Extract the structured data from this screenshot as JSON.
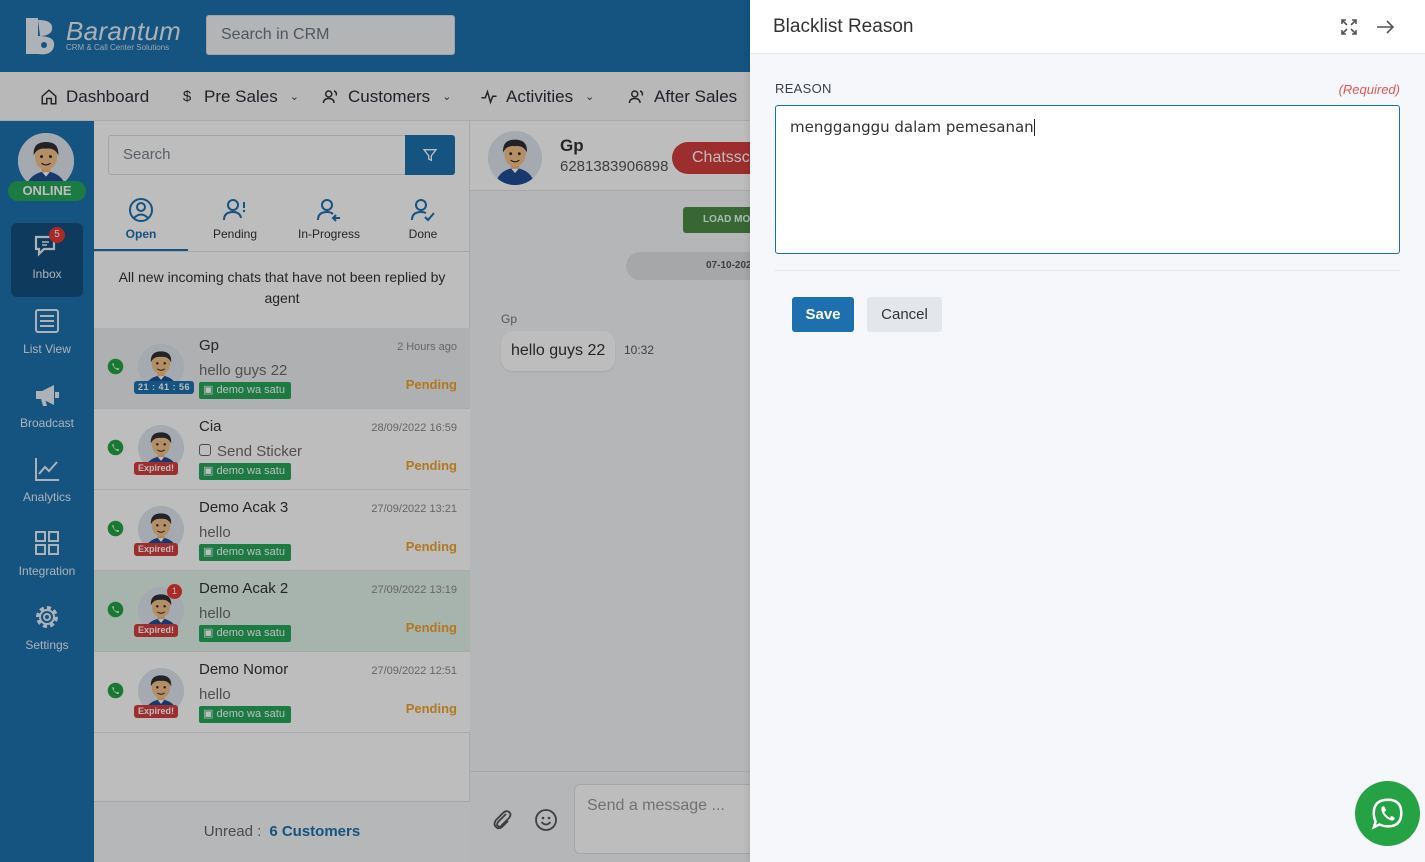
{
  "brand": {
    "name": "Barantum",
    "tagline": "CRM & Call Center Solutions",
    "accent": "#1d70ad"
  },
  "top_search": {
    "placeholder": "Search in CRM"
  },
  "nav": [
    {
      "label": "Dashboard",
      "icon": "home-icon"
    },
    {
      "label": "Pre Sales",
      "icon": "dollar-icon"
    },
    {
      "label": "Customers",
      "icon": "users-icon"
    },
    {
      "label": "Activities",
      "icon": "pulse-icon"
    },
    {
      "label": "After Sales",
      "icon": "users-icon"
    }
  ],
  "agent": {
    "status": "ONLINE"
  },
  "sidebar": [
    {
      "label": "Inbox",
      "icon": "chat-icon",
      "badge": "5"
    },
    {
      "label": "List View",
      "icon": "list-icon"
    },
    {
      "label": "Broadcast",
      "icon": "megaphone-icon"
    },
    {
      "label": "Analytics",
      "icon": "chart-icon"
    },
    {
      "label": "Integration",
      "icon": "grid-icon"
    },
    {
      "label": "Settings",
      "icon": "gear-icon"
    }
  ],
  "chatlist": {
    "search_placeholder": "Search",
    "tabs": [
      {
        "label": "Open",
        "icon": "user-circle-icon"
      },
      {
        "label": "Pending",
        "icon": "user-alert-icon"
      },
      {
        "label": "In-Progress",
        "icon": "user-progress-icon"
      },
      {
        "label": "Done",
        "icon": "user-check-icon"
      }
    ],
    "description": "All new incoming chats that have not been replied by agent",
    "chats": [
      {
        "name": "Gp",
        "time": "2 Hours ago",
        "message": "hello guys 22",
        "label": "demo wa satu",
        "status": "Pending",
        "tag": "21 : 41 : 56"
      },
      {
        "name": "Cia",
        "time": "28/09/2022 16:59",
        "message": "Send Sticker",
        "label": "demo wa satu",
        "status": "Pending",
        "tag": "Expired!"
      },
      {
        "name": "Demo Acak 3",
        "time": "27/09/2022 13:21",
        "message": "hello",
        "label": "demo wa satu",
        "status": "Pending",
        "tag": "Expired!"
      },
      {
        "name": "Demo Acak 2",
        "time": "27/09/2022 13:19",
        "message": "hello",
        "label": "demo wa satu",
        "status": "Pending",
        "tag": "Expired!",
        "badge": "1"
      },
      {
        "name": "Demo Nomor",
        "time": "27/09/2022 12:51",
        "message": "hello",
        "label": "demo wa satu",
        "status": "Pending",
        "tag": "Expired!"
      }
    ],
    "unread_label": "Unread :",
    "unread_count": "6 Customers"
  },
  "conversation": {
    "name": "Gp",
    "phone": "6281383906898",
    "action": "Chatssc",
    "load_more": "LOAD MO",
    "date": "07-10-202",
    "sender": "Gp",
    "message": "hello guys 22",
    "message_time": "10:32",
    "compose_placeholder": "Send a message ..."
  },
  "panel": {
    "title": "Blacklist Reason",
    "field_label": "REASON",
    "required_text": "(Required)",
    "reason_value": "mengganggu dalam pemesanan",
    "save_label": "Save",
    "cancel_label": "Cancel"
  },
  "colors": {
    "online": "#26a65b",
    "pending": "#f0a32a",
    "expired": "#d33f3f",
    "required": "#e05656"
  }
}
